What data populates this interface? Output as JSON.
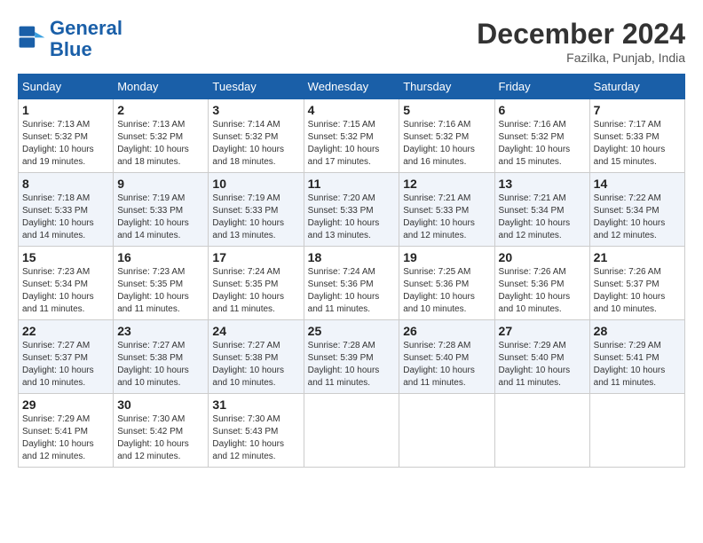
{
  "logo": {
    "line1": "General",
    "line2": "Blue"
  },
  "title": "December 2024",
  "subtitle": "Fazilka, Punjab, India",
  "weekdays": [
    "Sunday",
    "Monday",
    "Tuesday",
    "Wednesday",
    "Thursday",
    "Friday",
    "Saturday"
  ],
  "weeks": [
    [
      {
        "day": "1",
        "sunrise": "7:13 AM",
        "sunset": "5:32 PM",
        "daylight": "10 hours and 19 minutes."
      },
      {
        "day": "2",
        "sunrise": "7:13 AM",
        "sunset": "5:32 PM",
        "daylight": "10 hours and 18 minutes."
      },
      {
        "day": "3",
        "sunrise": "7:14 AM",
        "sunset": "5:32 PM",
        "daylight": "10 hours and 18 minutes."
      },
      {
        "day": "4",
        "sunrise": "7:15 AM",
        "sunset": "5:32 PM",
        "daylight": "10 hours and 17 minutes."
      },
      {
        "day": "5",
        "sunrise": "7:16 AM",
        "sunset": "5:32 PM",
        "daylight": "10 hours and 16 minutes."
      },
      {
        "day": "6",
        "sunrise": "7:16 AM",
        "sunset": "5:32 PM",
        "daylight": "10 hours and 15 minutes."
      },
      {
        "day": "7",
        "sunrise": "7:17 AM",
        "sunset": "5:33 PM",
        "daylight": "10 hours and 15 minutes."
      }
    ],
    [
      {
        "day": "8",
        "sunrise": "7:18 AM",
        "sunset": "5:33 PM",
        "daylight": "10 hours and 14 minutes."
      },
      {
        "day": "9",
        "sunrise": "7:19 AM",
        "sunset": "5:33 PM",
        "daylight": "10 hours and 14 minutes."
      },
      {
        "day": "10",
        "sunrise": "7:19 AM",
        "sunset": "5:33 PM",
        "daylight": "10 hours and 13 minutes."
      },
      {
        "day": "11",
        "sunrise": "7:20 AM",
        "sunset": "5:33 PM",
        "daylight": "10 hours and 13 minutes."
      },
      {
        "day": "12",
        "sunrise": "7:21 AM",
        "sunset": "5:33 PM",
        "daylight": "10 hours and 12 minutes."
      },
      {
        "day": "13",
        "sunrise": "7:21 AM",
        "sunset": "5:34 PM",
        "daylight": "10 hours and 12 minutes."
      },
      {
        "day": "14",
        "sunrise": "7:22 AM",
        "sunset": "5:34 PM",
        "daylight": "10 hours and 12 minutes."
      }
    ],
    [
      {
        "day": "15",
        "sunrise": "7:23 AM",
        "sunset": "5:34 PM",
        "daylight": "10 hours and 11 minutes."
      },
      {
        "day": "16",
        "sunrise": "7:23 AM",
        "sunset": "5:35 PM",
        "daylight": "10 hours and 11 minutes."
      },
      {
        "day": "17",
        "sunrise": "7:24 AM",
        "sunset": "5:35 PM",
        "daylight": "10 hours and 11 minutes."
      },
      {
        "day": "18",
        "sunrise": "7:24 AM",
        "sunset": "5:36 PM",
        "daylight": "10 hours and 11 minutes."
      },
      {
        "day": "19",
        "sunrise": "7:25 AM",
        "sunset": "5:36 PM",
        "daylight": "10 hours and 10 minutes."
      },
      {
        "day": "20",
        "sunrise": "7:26 AM",
        "sunset": "5:36 PM",
        "daylight": "10 hours and 10 minutes."
      },
      {
        "day": "21",
        "sunrise": "7:26 AM",
        "sunset": "5:37 PM",
        "daylight": "10 hours and 10 minutes."
      }
    ],
    [
      {
        "day": "22",
        "sunrise": "7:27 AM",
        "sunset": "5:37 PM",
        "daylight": "10 hours and 10 minutes."
      },
      {
        "day": "23",
        "sunrise": "7:27 AM",
        "sunset": "5:38 PM",
        "daylight": "10 hours and 10 minutes."
      },
      {
        "day": "24",
        "sunrise": "7:27 AM",
        "sunset": "5:38 PM",
        "daylight": "10 hours and 10 minutes."
      },
      {
        "day": "25",
        "sunrise": "7:28 AM",
        "sunset": "5:39 PM",
        "daylight": "10 hours and 11 minutes."
      },
      {
        "day": "26",
        "sunrise": "7:28 AM",
        "sunset": "5:40 PM",
        "daylight": "10 hours and 11 minutes."
      },
      {
        "day": "27",
        "sunrise": "7:29 AM",
        "sunset": "5:40 PM",
        "daylight": "10 hours and 11 minutes."
      },
      {
        "day": "28",
        "sunrise": "7:29 AM",
        "sunset": "5:41 PM",
        "daylight": "10 hours and 11 minutes."
      }
    ],
    [
      {
        "day": "29",
        "sunrise": "7:29 AM",
        "sunset": "5:41 PM",
        "daylight": "10 hours and 12 minutes."
      },
      {
        "day": "30",
        "sunrise": "7:30 AM",
        "sunset": "5:42 PM",
        "daylight": "10 hours and 12 minutes."
      },
      {
        "day": "31",
        "sunrise": "7:30 AM",
        "sunset": "5:43 PM",
        "daylight": "10 hours and 12 minutes."
      },
      null,
      null,
      null,
      null
    ]
  ],
  "labels": {
    "sunrise": "Sunrise:",
    "sunset": "Sunset:",
    "daylight": "Daylight:"
  }
}
